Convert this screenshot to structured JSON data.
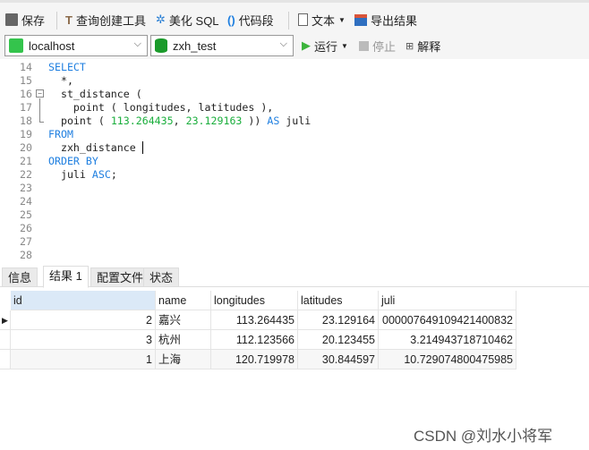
{
  "toolbar": {
    "save": "保存",
    "query_builder": "查询创建工具",
    "beautify": "美化 SQL",
    "snippet": "代码段",
    "text": "文本",
    "export": "导出结果"
  },
  "toolbar2": {
    "connection": "localhost",
    "database": "zxh_test",
    "run": "运行",
    "stop": "停止",
    "explain": "解释"
  },
  "editor": {
    "line_numbers": [
      "14",
      "15",
      "16",
      "17",
      "18",
      "19",
      "20",
      "21",
      "22",
      "23",
      "24",
      "25",
      "26",
      "27",
      "28"
    ]
  },
  "result_tabs": [
    "信息",
    "结果 1",
    "配置文件",
    "状态"
  ],
  "grid": {
    "columns": [
      "id",
      "name",
      "longitudes",
      "latitudes",
      "juli"
    ],
    "rows": [
      [
        "2",
        "嘉兴",
        "113.264435",
        "23.129164",
        "000007649109421400832"
      ],
      [
        "3",
        "杭州",
        "112.123566",
        "20.123455",
        "3.214943718710462"
      ],
      [
        "1",
        "上海",
        "120.719978",
        "30.844597",
        "10.729074800475985"
      ]
    ]
  },
  "watermark": "CSDN @刘水小将军"
}
